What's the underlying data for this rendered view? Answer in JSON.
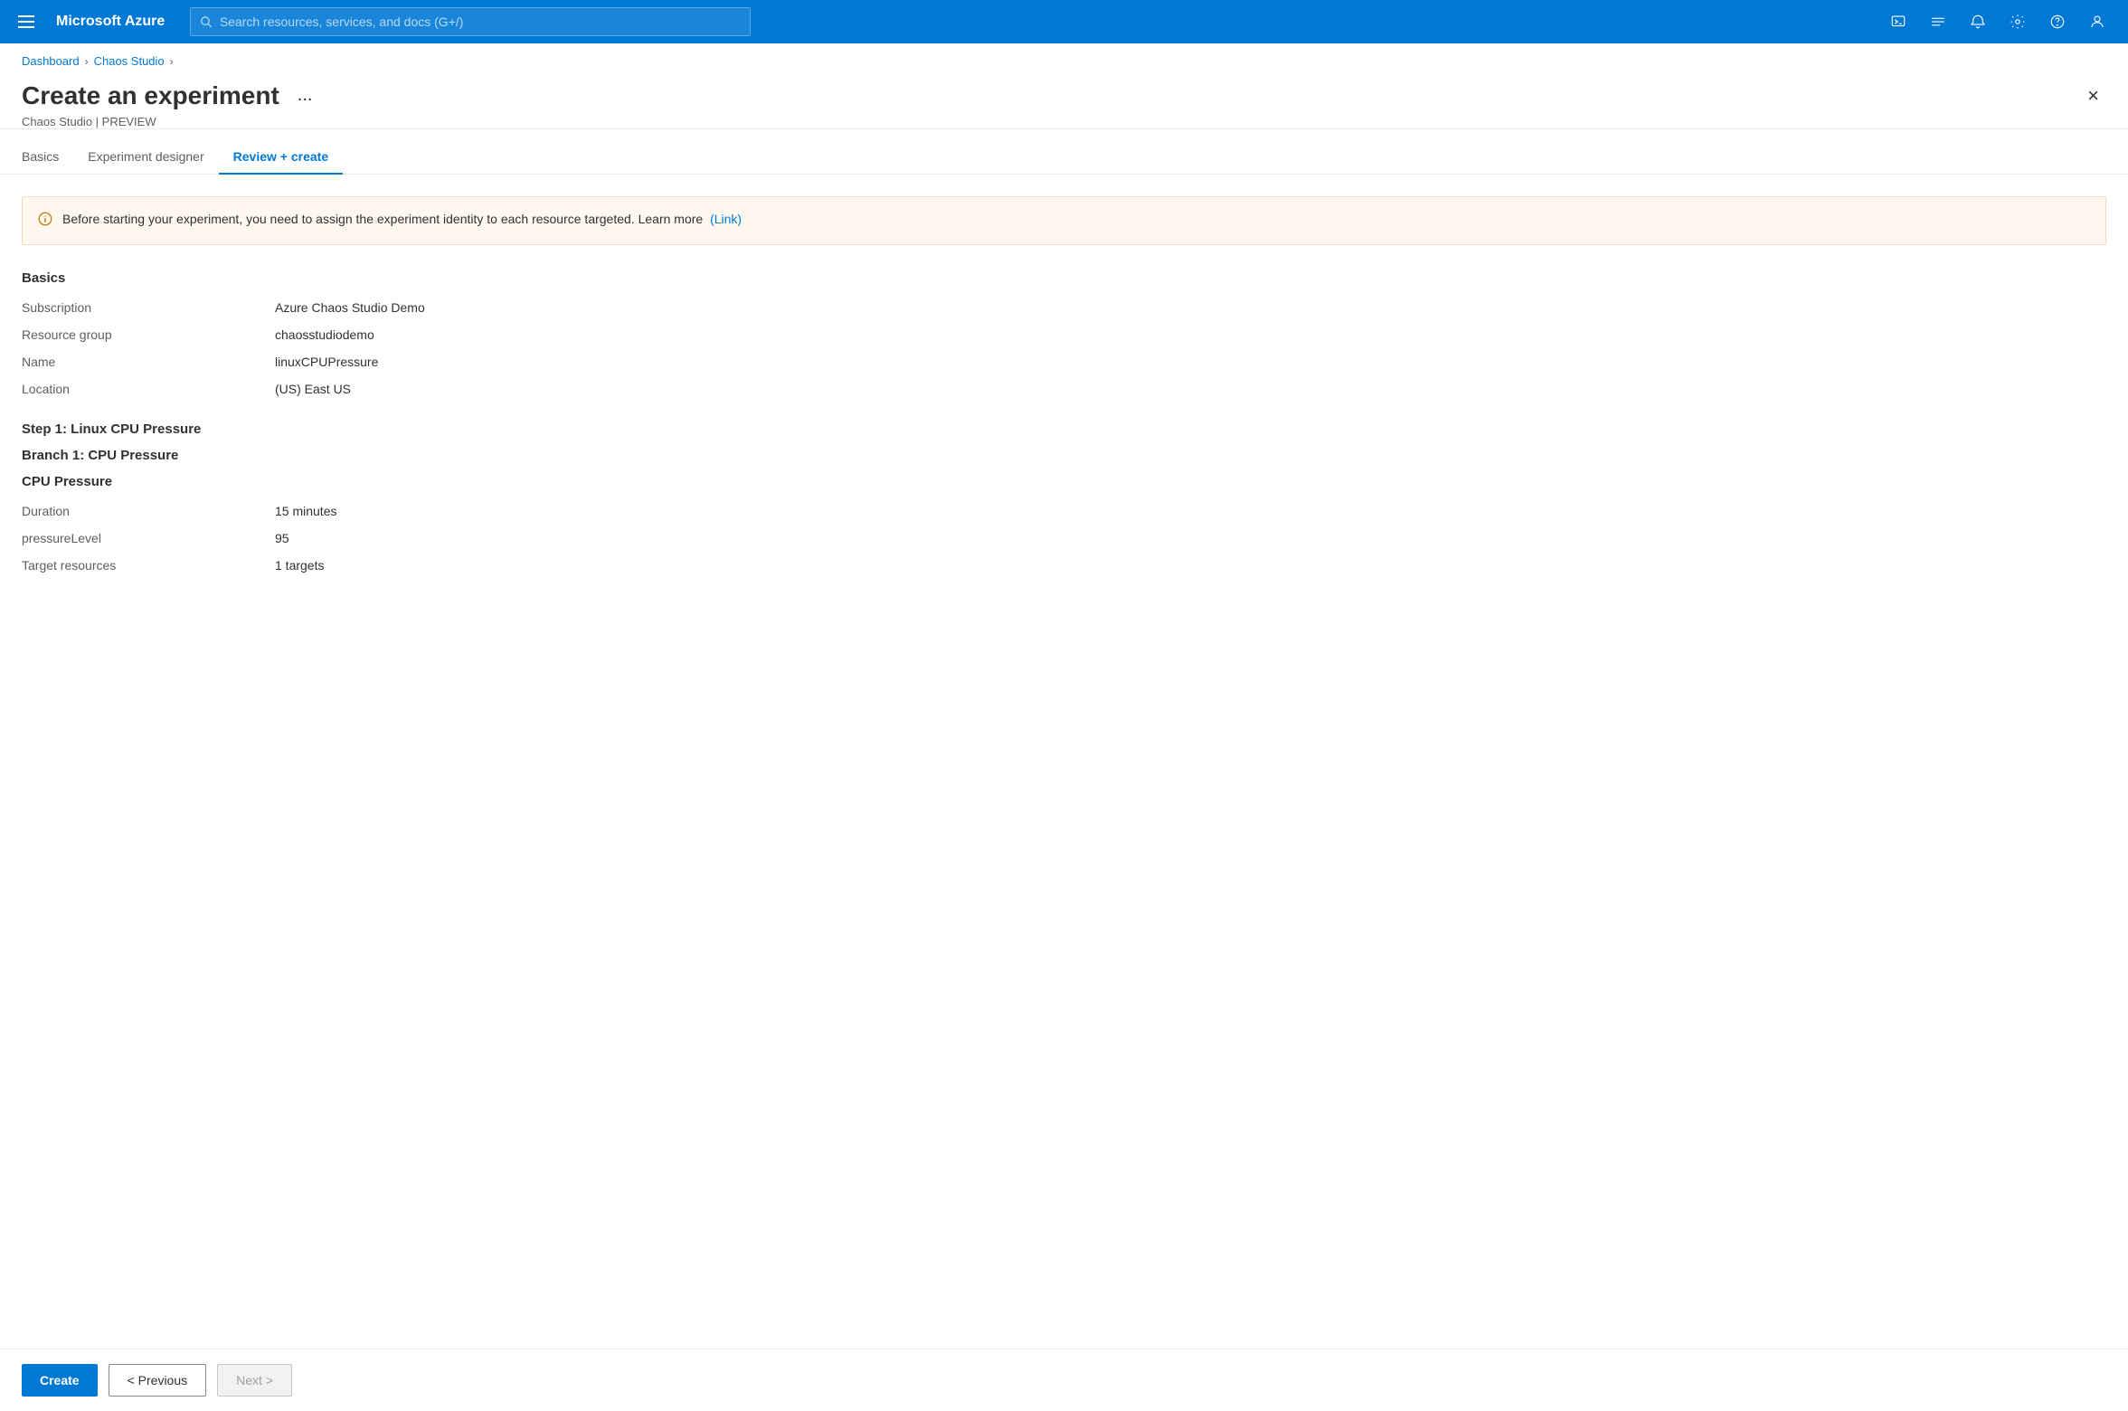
{
  "topnav": {
    "logo": "Microsoft Azure",
    "search_placeholder": "Search resources, services, and docs (G+/)"
  },
  "breadcrumb": {
    "items": [
      {
        "label": "Dashboard",
        "href": "#"
      },
      {
        "label": "Chaos Studio",
        "href": "#"
      }
    ]
  },
  "page": {
    "title": "Create an experiment",
    "subtitle": "Chaos Studio | PREVIEW",
    "ellipsis": "...",
    "close_label": "×"
  },
  "tabs": [
    {
      "label": "Basics",
      "active": false
    },
    {
      "label": "Experiment designer",
      "active": false
    },
    {
      "label": "Review + create",
      "active": true
    }
  ],
  "info_banner": {
    "text": "Before starting your experiment, you need to assign the experiment identity to each resource targeted. Learn more",
    "link_label": "(Link)"
  },
  "basics_section": {
    "title": "Basics",
    "fields": [
      {
        "label": "Subscription",
        "value": "Azure Chaos Studio Demo"
      },
      {
        "label": "Resource group",
        "value": "chaosstudiodemo"
      },
      {
        "label": "Name",
        "value": "linuxCPUPressure"
      },
      {
        "label": "Location",
        "value": "(US) East US"
      }
    ]
  },
  "step_section": {
    "step_title": "Step 1: Linux CPU Pressure",
    "branch_title": "Branch 1: CPU Pressure",
    "fault_title": "CPU Pressure",
    "fields": [
      {
        "label": "Duration",
        "value": "15 minutes"
      },
      {
        "label": "pressureLevel",
        "value": "95"
      },
      {
        "label": "Target resources",
        "value": "1 targets"
      }
    ]
  },
  "footer": {
    "create_label": "Create",
    "previous_label": "< Previous",
    "next_label": "Next >"
  }
}
